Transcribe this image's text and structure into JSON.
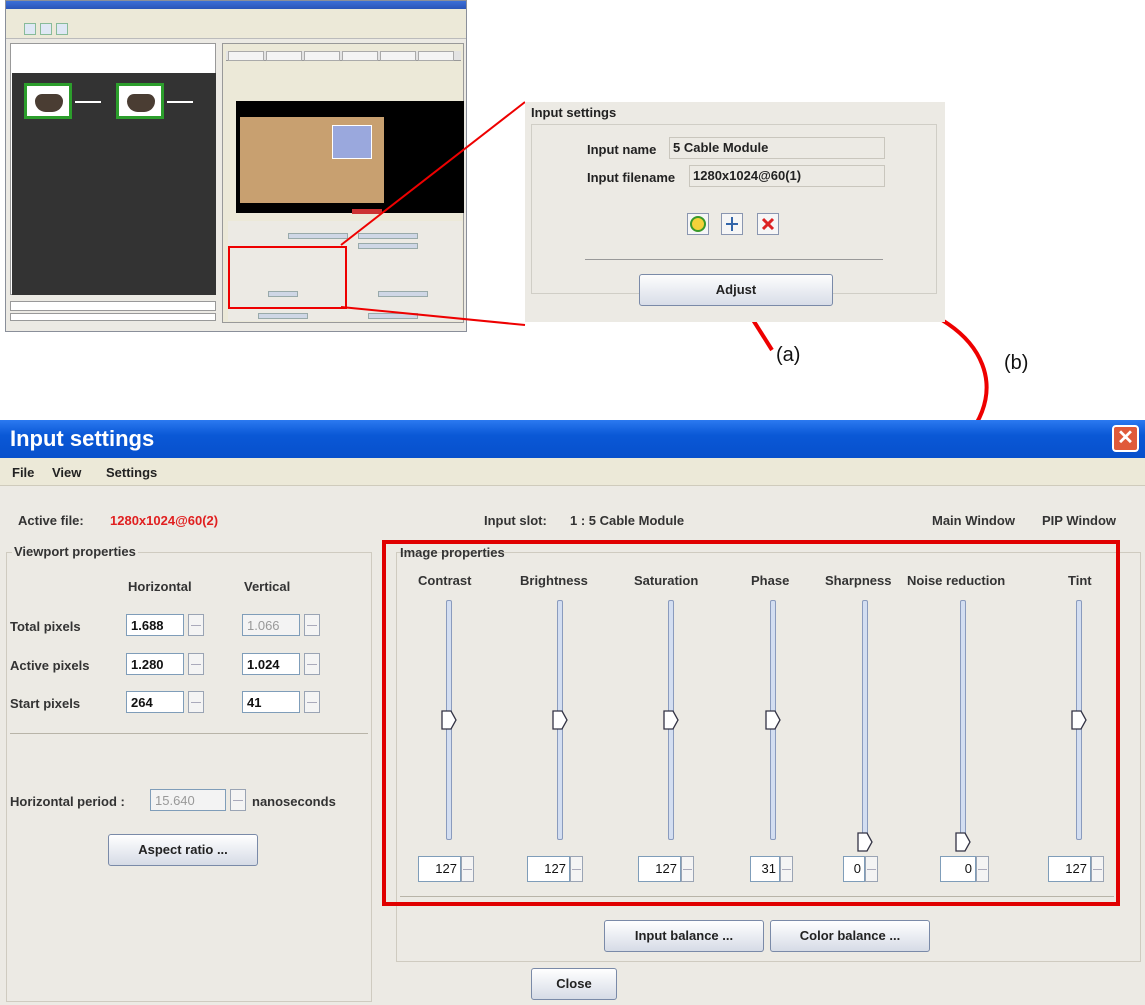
{
  "zoom_panel": {
    "title": "Input settings",
    "input_name_label": "Input name",
    "input_name_value": "5 Cable Module",
    "input_filename_label": "Input filename",
    "input_filename_value": "1280x1024@60(1)",
    "adjust_button": "Adjust",
    "icons": [
      "refresh-icon",
      "anchor-icon",
      "delete-icon"
    ]
  },
  "annotations": {
    "a": "(a)",
    "b": "(b)"
  },
  "window": {
    "title": "Input settings",
    "menu": [
      "File",
      "View",
      "Settings"
    ],
    "active_file_label": "Active file:",
    "active_file_value": "1280x1024@60(2)",
    "input_slot_label": "Input slot:",
    "input_slot_value": "1 : 5 Cable Module",
    "main_window": "Main Window",
    "pip_window": "PIP Window",
    "viewport": {
      "title": "Viewport properties",
      "col_horizontal": "Horizontal",
      "col_vertical": "Vertical",
      "rows": [
        {
          "label": "Total pixels",
          "horizontal": "1.688",
          "vertical": "1.066"
        },
        {
          "label": "Active pixels",
          "horizontal": "1.280",
          "vertical": "1.024"
        },
        {
          "label": "Start pixels",
          "horizontal": "264",
          "vertical": "41"
        }
      ],
      "horizontal_period_label": "Horizontal period :",
      "horizontal_period_value": "15.640",
      "horizontal_period_unit": "nanoseconds",
      "aspect_ratio_button": "Aspect ratio ..."
    },
    "image_properties": {
      "title": "Image properties",
      "sliders": [
        {
          "label": "Contrast",
          "value": "127"
        },
        {
          "label": "Brightness",
          "value": "127"
        },
        {
          "label": "Saturation",
          "value": "127"
        },
        {
          "label": "Phase",
          "value": "31"
        },
        {
          "label": "Sharpness",
          "value": "0"
        },
        {
          "label": "Noise reduction",
          "value": "0"
        },
        {
          "label": "Tint",
          "value": "127"
        }
      ]
    },
    "input_balance_button": "Input balance ...",
    "color_balance_button": "Color balance ...",
    "close_button": "Close"
  },
  "colors": {
    "highlight_red": "#e00000",
    "title_blue": "#0a58d6",
    "active_file_red": "#e02020"
  }
}
